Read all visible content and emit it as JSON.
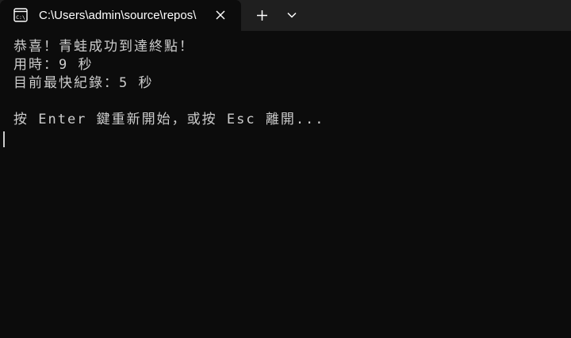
{
  "tab": {
    "title": "C:\\Users\\admin\\source\\repos\\",
    "icon": "terminal-icon"
  },
  "controls": {
    "close_icon": "close-icon",
    "new_tab_icon": "plus-icon",
    "dropdown_icon": "chevron-down-icon"
  },
  "console": {
    "lines": [
      "恭喜！青蛙成功到達終點！",
      "用時：9 秒",
      "目前最快紀錄：5 秒",
      "",
      "按 Enter 鍵重新開始，或按 Esc 離開..."
    ]
  },
  "colors": {
    "background": "#0c0c0c",
    "titlebar": "#1f1f1f",
    "text": "#cccccc"
  }
}
